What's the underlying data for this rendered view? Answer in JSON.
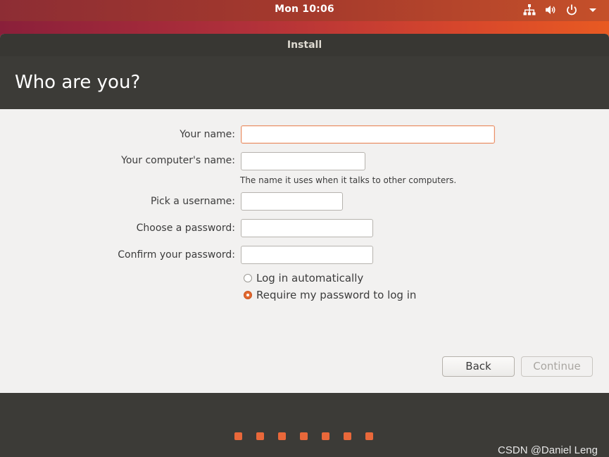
{
  "topbar": {
    "clock": "Mon 10:06",
    "icons": [
      "network-icon",
      "volume-icon",
      "power-icon",
      "menu-arrow-icon"
    ]
  },
  "window": {
    "title": "Install",
    "heading": "Who are you?"
  },
  "form": {
    "your_name_label": "Your name:",
    "your_name_value": "",
    "computer_name_label": "Your computer's name:",
    "computer_name_value": "",
    "computer_name_hint": "The name it uses when it talks to other computers.",
    "username_label": "Pick a username:",
    "username_value": "",
    "password_label": "Choose a password:",
    "password_value": "",
    "confirm_label": "Confirm your password:",
    "confirm_value": "",
    "login_options": [
      {
        "label": "Log in automatically",
        "selected": false
      },
      {
        "label": "Require my password to log in",
        "selected": true
      }
    ]
  },
  "buttons": {
    "back": "Back",
    "continue": "Continue"
  },
  "progress": {
    "steps_total": 7
  },
  "watermark": "CSDN @Daniel Leng",
  "colors": {
    "accent": "#e9683a",
    "header_bg": "#3c3b37",
    "window_bg": "#f2f1f0"
  }
}
